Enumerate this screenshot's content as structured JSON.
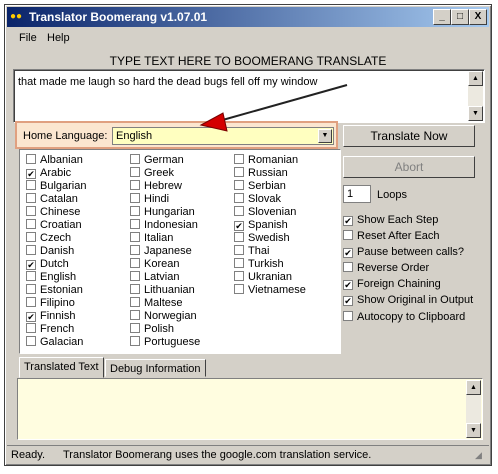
{
  "window": {
    "title": "Translator Boomerang v1.07.01"
  },
  "titlebar_buttons": {
    "minimize": "_",
    "maximize": "□",
    "close": "X"
  },
  "menu": {
    "items": [
      "File",
      "Help"
    ]
  },
  "instruction": "TYPE TEXT HERE TO BOOMERANG TRANSLATE",
  "input_text": "that made me laugh so hard the dead bugs fell off my window",
  "home_language": {
    "label": "Home Language:",
    "value": "English"
  },
  "languages": {
    "col1": [
      {
        "name": "Albanian",
        "checked": false
      },
      {
        "name": "Arabic",
        "checked": true
      },
      {
        "name": "Bulgarian",
        "checked": false
      },
      {
        "name": "Catalan",
        "checked": false
      },
      {
        "name": "Chinese",
        "checked": false
      },
      {
        "name": "Croatian",
        "checked": false
      },
      {
        "name": "Czech",
        "checked": false
      },
      {
        "name": "Danish",
        "checked": false
      },
      {
        "name": "Dutch",
        "checked": true
      },
      {
        "name": "English",
        "checked": false
      },
      {
        "name": "Estonian",
        "checked": false
      },
      {
        "name": "Filipino",
        "checked": false
      },
      {
        "name": "Finnish",
        "checked": true
      },
      {
        "name": "French",
        "checked": false
      },
      {
        "name": "Galacian",
        "checked": false
      }
    ],
    "col2": [
      {
        "name": "German",
        "checked": false
      },
      {
        "name": "Greek",
        "checked": false
      },
      {
        "name": "Hebrew",
        "checked": false
      },
      {
        "name": "Hindi",
        "checked": false
      },
      {
        "name": "Hungarian",
        "checked": false
      },
      {
        "name": "Indonesian",
        "checked": false
      },
      {
        "name": "Italian",
        "checked": false
      },
      {
        "name": "Japanese",
        "checked": false
      },
      {
        "name": "Korean",
        "checked": false
      },
      {
        "name": "Latvian",
        "checked": false
      },
      {
        "name": "Lithuanian",
        "checked": false
      },
      {
        "name": "Maltese",
        "checked": false
      },
      {
        "name": "Norwegian",
        "checked": false
      },
      {
        "name": "Polish",
        "checked": false
      },
      {
        "name": "Portuguese",
        "checked": false
      }
    ],
    "col3": [
      {
        "name": "Romanian",
        "checked": false
      },
      {
        "name": "Russian",
        "checked": false
      },
      {
        "name": "Serbian",
        "checked": false
      },
      {
        "name": "Slovak",
        "checked": false
      },
      {
        "name": "Slovenian",
        "checked": false
      },
      {
        "name": "Spanish",
        "checked": true
      },
      {
        "name": "Swedish",
        "checked": false
      },
      {
        "name": "Thai",
        "checked": false
      },
      {
        "name": "Turkish",
        "checked": false
      },
      {
        "name": "Ukranian",
        "checked": false
      },
      {
        "name": "Vietnamese",
        "checked": false
      }
    ]
  },
  "buttons": {
    "translate": "Translate Now",
    "abort": "Abort"
  },
  "loops": {
    "value": "1",
    "label": "Loops"
  },
  "options": [
    {
      "label": "Show Each Step",
      "checked": true
    },
    {
      "label": "Reset After Each",
      "checked": false
    },
    {
      "label": "Pause between calls?",
      "checked": true
    },
    {
      "label": "Reverse Order",
      "checked": false
    },
    {
      "label": "Foreign Chaining",
      "checked": true
    },
    {
      "label": "Show Original in Output",
      "checked": true
    },
    {
      "label": "Autocopy to Clipboard",
      "checked": false
    }
  ],
  "tabs": [
    {
      "label": "Translated Text",
      "active": true
    },
    {
      "label": "Debug Information",
      "active": false
    }
  ],
  "status": {
    "state": "Ready.",
    "message": "Translator Boomerang uses the google.com translation service."
  },
  "colors": {
    "annotation_arrow": "#d40000",
    "highlight_box": "#fbe6d0",
    "combo_bg": "#ffffc0"
  },
  "icons": [
    "app-icon",
    "checkmark-icon",
    "dropdown-arrow-icon",
    "scroll-up-icon",
    "scroll-down-icon",
    "size-grip-icon"
  ]
}
